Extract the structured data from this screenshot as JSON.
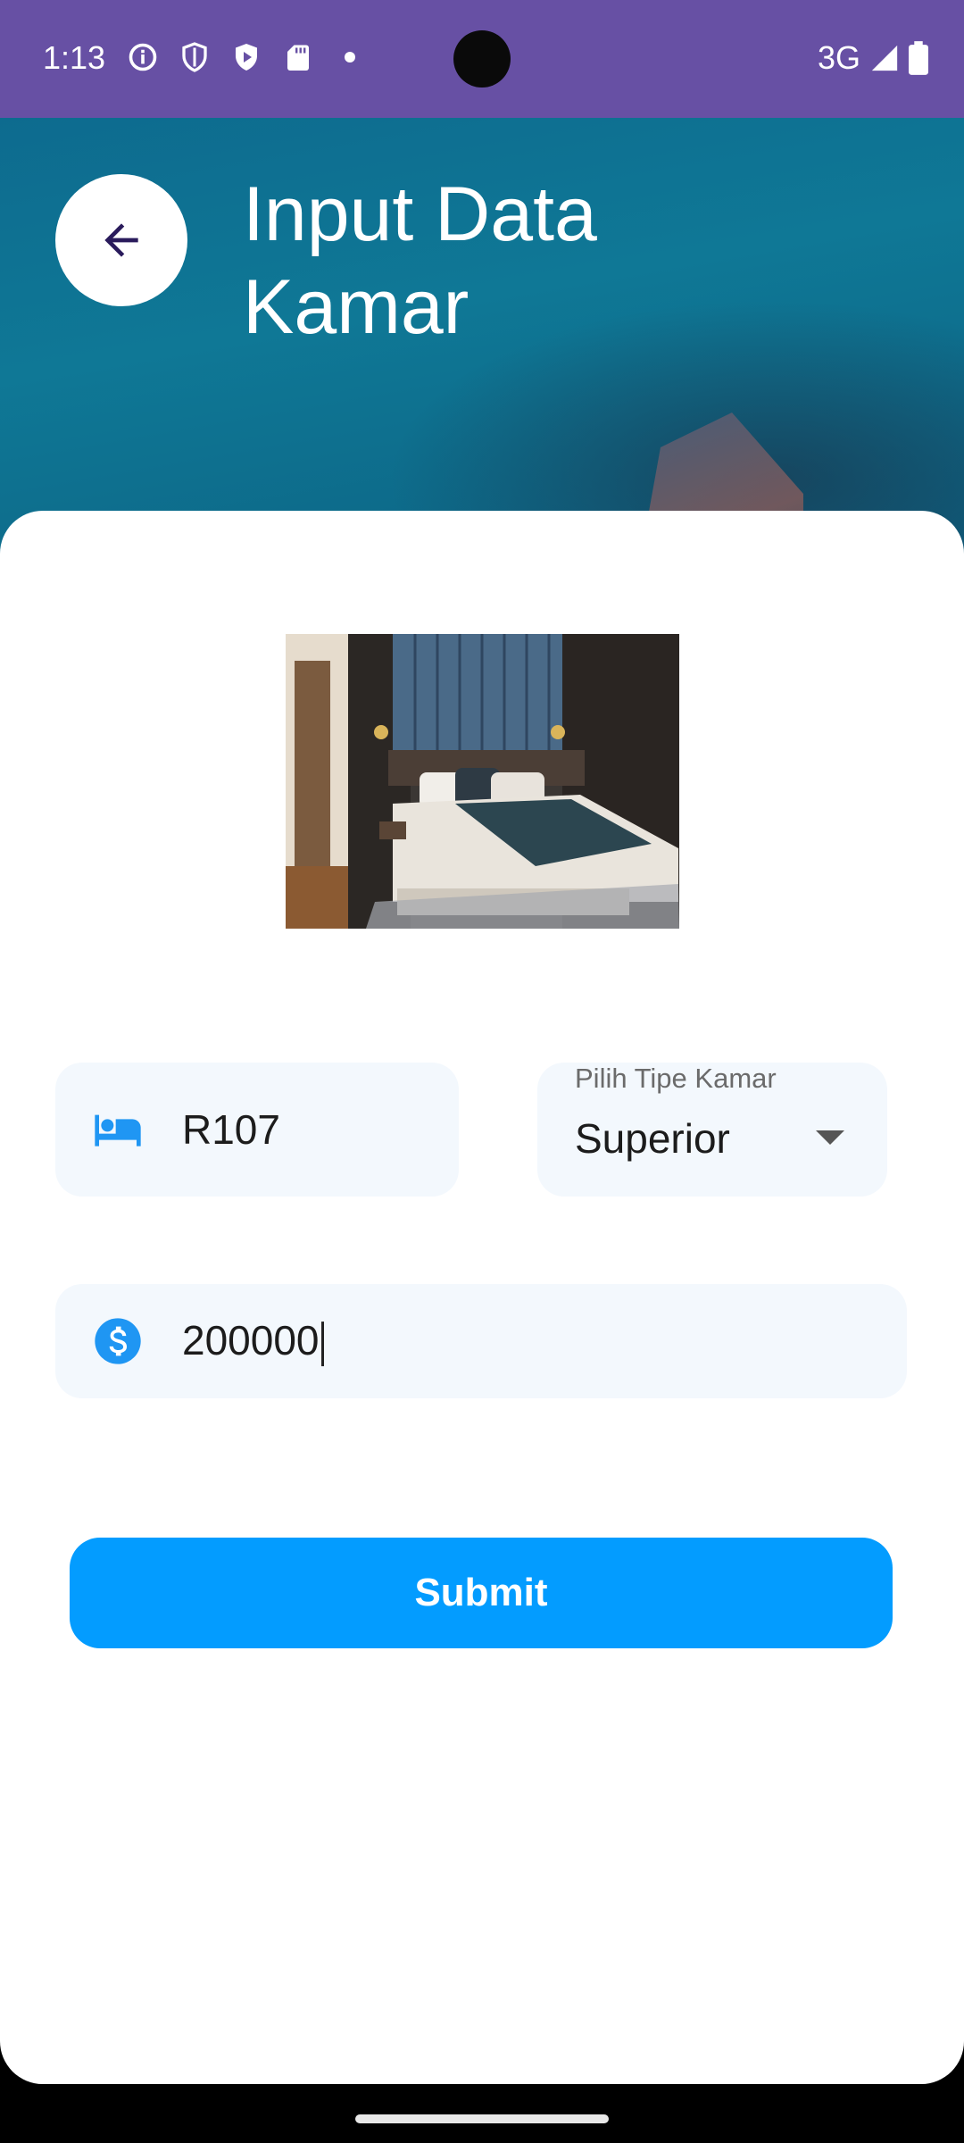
{
  "status_bar": {
    "time": "1:13",
    "network": "3G"
  },
  "header": {
    "title": "Input Data Kamar"
  },
  "form": {
    "room_number": {
      "value": "R107"
    },
    "room_type": {
      "label": "Pilih Tipe Kamar",
      "value": "Superior"
    },
    "price": {
      "value": "200000"
    },
    "submit_label": "Submit"
  },
  "colors": {
    "status_bar": "#6750a4",
    "accent": "#039cff",
    "field_bg": "#f3f8fd"
  }
}
